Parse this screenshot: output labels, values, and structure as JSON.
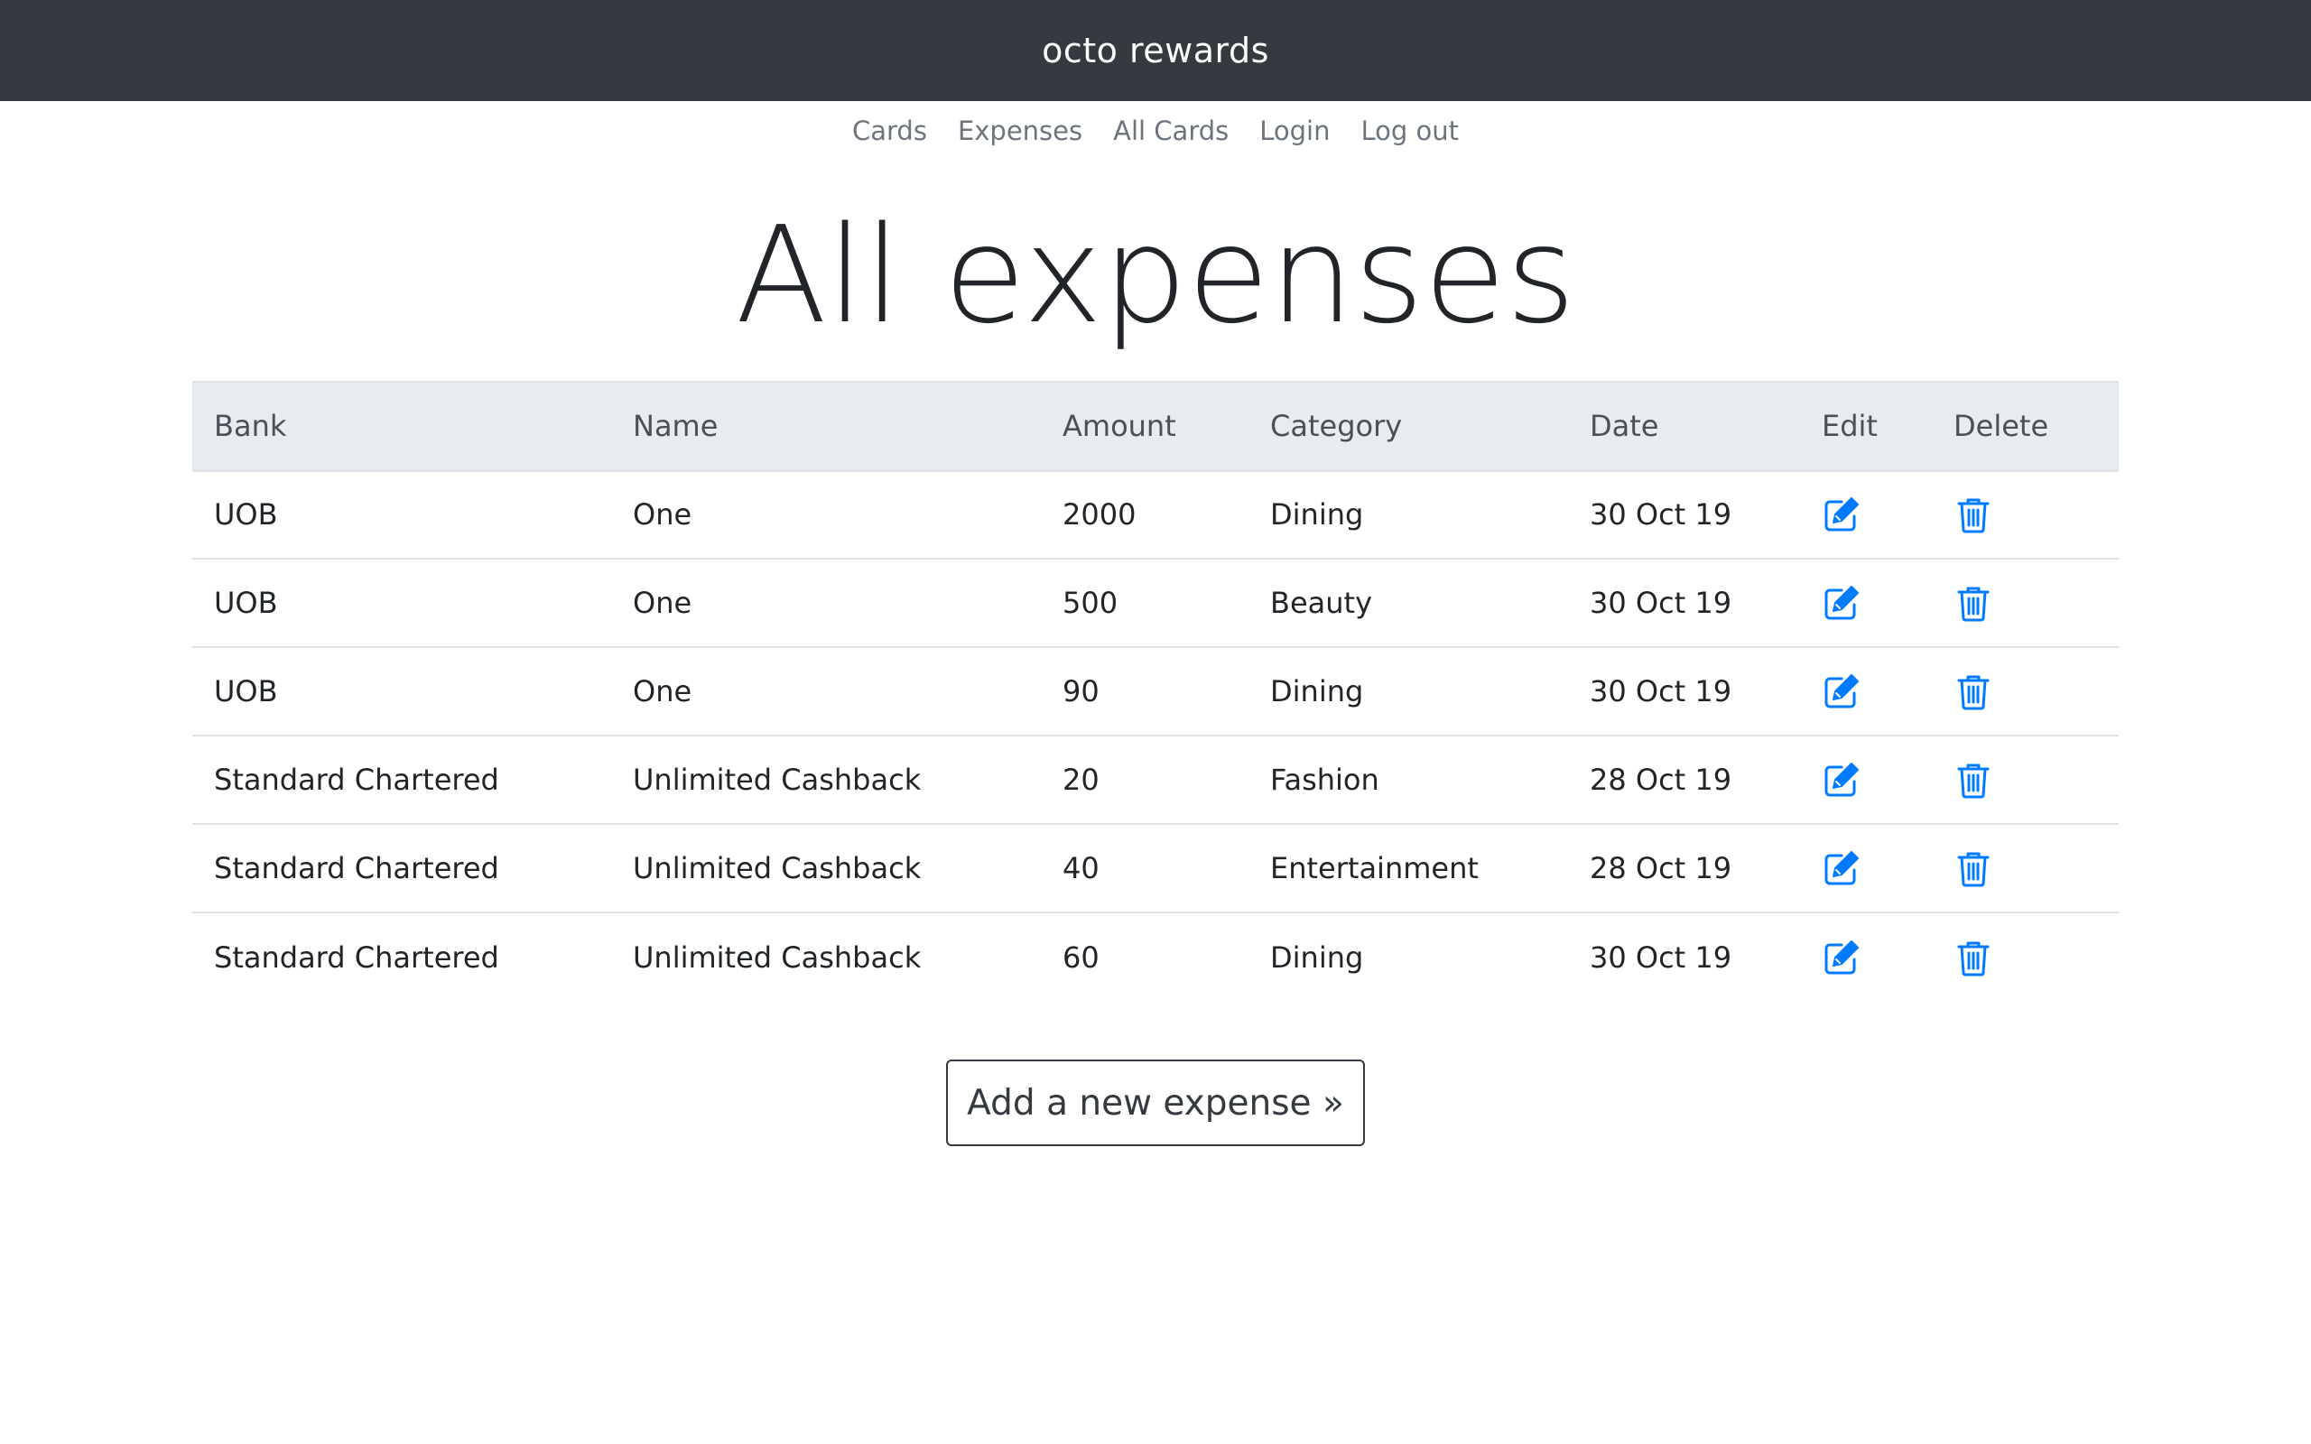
{
  "header": {
    "brand": "octo rewards"
  },
  "nav": {
    "items": [
      {
        "label": "Cards"
      },
      {
        "label": "Expenses"
      },
      {
        "label": "All Cards"
      },
      {
        "label": "Login"
      },
      {
        "label": "Log out"
      }
    ]
  },
  "main": {
    "title": "All expenses",
    "columns": [
      "Bank",
      "Name",
      "Amount",
      "Category",
      "Date",
      "Edit",
      "Delete"
    ],
    "rows": [
      {
        "bank": "UOB",
        "name": "One",
        "amount": "2000",
        "category": "Dining",
        "date": "30 Oct 19"
      },
      {
        "bank": "UOB",
        "name": "One",
        "amount": "500",
        "category": "Beauty",
        "date": "30 Oct 19"
      },
      {
        "bank": "UOB",
        "name": "One",
        "amount": "90",
        "category": "Dining",
        "date": "30 Oct 19"
      },
      {
        "bank": "Standard Chartered",
        "name": "Unlimited Cashback",
        "amount": "20",
        "category": "Fashion",
        "date": "28 Oct 19"
      },
      {
        "bank": "Standard Chartered",
        "name": "Unlimited Cashback",
        "amount": "40",
        "category": "Entertainment",
        "date": "28 Oct 19"
      },
      {
        "bank": "Standard Chartered",
        "name": "Unlimited Cashback",
        "amount": "60",
        "category": "Dining",
        "date": "30 Oct 19"
      }
    ],
    "edit_icon": "edit-icon",
    "delete_icon": "trash-icon",
    "add_button_label": "Add a new expense »"
  },
  "colors": {
    "topbar": "#343a40",
    "accent": "#007bff",
    "header_row": "#e9ecef"
  }
}
